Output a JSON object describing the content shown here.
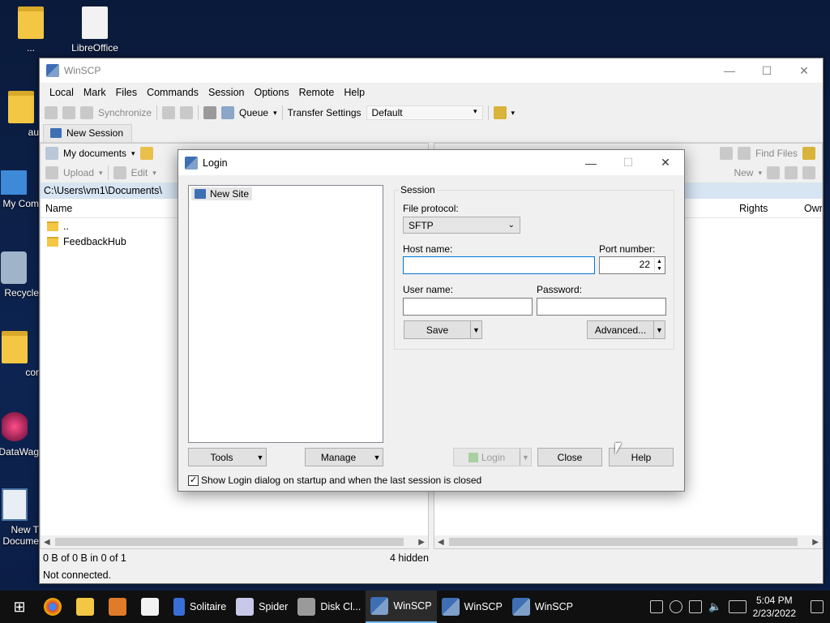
{
  "desktop": {
    "icons": [
      {
        "label": "..."
      },
      {
        "label": "LibreOffice"
      },
      {
        "label": "aux"
      },
      {
        "label": "My Com"
      },
      {
        "label": "Recycle"
      },
      {
        "label": "cor"
      },
      {
        "label": "DataWag"
      },
      {
        "label": "New T Docume"
      }
    ]
  },
  "window": {
    "title": "WinSCP",
    "menu": [
      "Local",
      "Mark",
      "Files",
      "Commands",
      "Session",
      "Options",
      "Remote",
      "Help"
    ],
    "toolbar": {
      "synchronize": "Synchronize",
      "queue": "Queue",
      "transfer_settings_label": "Transfer Settings",
      "transfer_settings_value": "Default"
    },
    "tab": "New Session",
    "left_pane": {
      "location": "My documents",
      "upload": "Upload",
      "edit": "Edit",
      "path": "C:\\Users\\vm1\\Documents\\",
      "column_name": "Name",
      "files": [
        {
          "name": ".."
        },
        {
          "name": "FeedbackHub"
        }
      ]
    },
    "right_pane": {
      "find_files": "Find Files",
      "new": "New",
      "col_rights": "Rights",
      "col_owner": "Owr"
    },
    "status": {
      "selection": "0 B of 0 B in 0 of 1",
      "hidden": "4 hidden",
      "connection": "Not connected."
    }
  },
  "login": {
    "title": "Login",
    "site": "New Site",
    "session_caption": "Session",
    "file_protocol_label": "File protocol:",
    "file_protocol_value": "SFTP",
    "host_label": "Host name:",
    "host_value": "",
    "port_label": "Port number:",
    "port_value": "22",
    "user_label": "User name:",
    "user_value": "",
    "password_label": "Password:",
    "password_value": "",
    "save": "Save",
    "advanced": "Advanced...",
    "tools": "Tools",
    "manage": "Manage",
    "login_btn": "Login",
    "close": "Close",
    "help": "Help",
    "show_on_startup": "Show Login dialog on startup and when the last session is closed",
    "show_on_startup_checked": true
  },
  "taskbar": {
    "apps": [
      {
        "label": ""
      },
      {
        "label": ""
      },
      {
        "label": ""
      },
      {
        "label": ""
      },
      {
        "label": "Solitaire"
      },
      {
        "label": "Spider"
      },
      {
        "label": "Disk Cl..."
      },
      {
        "label": "WinSCP"
      },
      {
        "label": "WinSCP"
      },
      {
        "label": "WinSCP"
      }
    ],
    "time": "5:04 PM",
    "date": "2/23/2022"
  }
}
